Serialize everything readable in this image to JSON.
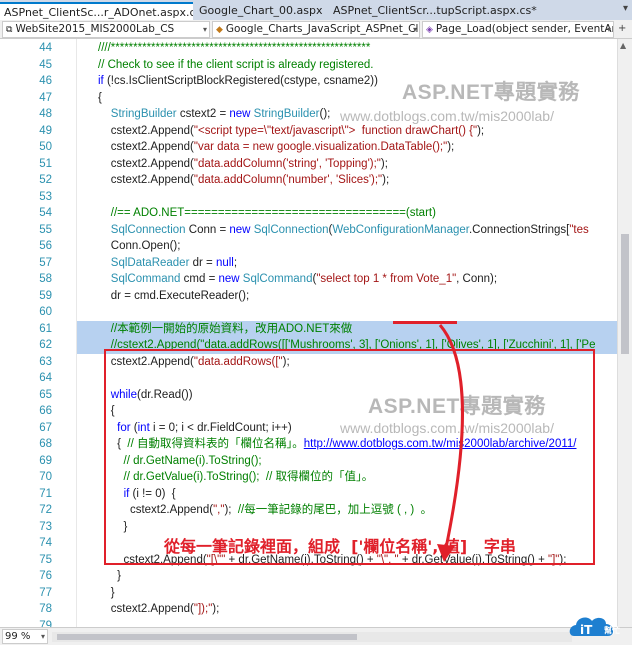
{
  "tabs": [
    {
      "label": "ASPnet_ClientSc...r_ADOnet.aspx.cs",
      "active": true
    },
    {
      "label": "Google_Chart_00.aspx",
      "active": false
    },
    {
      "label": "ASPnet_ClientScr...tupScript.aspx.cs*",
      "active": false
    }
  ],
  "nav": {
    "project": "WebSite2015_MIS2000Lab_CS",
    "class": "Google_Charts_JavaScript_ASPnet_ClientS",
    "member": "Page_Load(object sender, EventArgs e)"
  },
  "zoom": "99 %",
  "code_lines": [
    {
      "n": "44",
      "tokens": [
        {
          "t": "////**********************************************************",
          "c": "cm"
        }
      ]
    },
    {
      "n": "45",
      "tokens": [
        {
          "t": "// Check to see if the client script is already registered.",
          "c": "cm"
        }
      ]
    },
    {
      "n": "46",
      "tokens": [
        {
          "t": "if",
          "c": "kw"
        },
        {
          "t": " (!cs.IsClientScriptBlockRegistered(cstype, csname2))",
          "c": "pl"
        }
      ]
    },
    {
      "n": "47",
      "tokens": [
        {
          "t": "{",
          "c": "pl"
        }
      ]
    },
    {
      "n": "48",
      "tokens": [
        {
          "t": "    ",
          "c": "pl"
        },
        {
          "t": "StringBuilder",
          "c": "ty"
        },
        {
          "t": " cstext2 = ",
          "c": "pl"
        },
        {
          "t": "new",
          "c": "kw"
        },
        {
          "t": " ",
          "c": "pl"
        },
        {
          "t": "StringBuilder",
          "c": "ty"
        },
        {
          "t": "();",
          "c": "pl"
        }
      ]
    },
    {
      "n": "49",
      "tokens": [
        {
          "t": "    cstext2.Append(",
          "c": "pl"
        },
        {
          "t": "\"<script type=\\\"text/javascript\\\">  function drawChart() {\"",
          "c": "str"
        },
        {
          "t": ");",
          "c": "pl"
        }
      ]
    },
    {
      "n": "50",
      "tokens": [
        {
          "t": "    cstext2.Append(",
          "c": "pl"
        },
        {
          "t": "\"var data = new google.visualization.DataTable();\"",
          "c": "str"
        },
        {
          "t": ");",
          "c": "pl"
        }
      ]
    },
    {
      "n": "51",
      "tokens": [
        {
          "t": "    cstext2.Append(",
          "c": "pl"
        },
        {
          "t": "\"data.addColumn('string', 'Topping');\"",
          "c": "str"
        },
        {
          "t": ");",
          "c": "pl"
        }
      ]
    },
    {
      "n": "52",
      "tokens": [
        {
          "t": "    cstext2.Append(",
          "c": "pl"
        },
        {
          "t": "\"data.addColumn('number', 'Slices');\"",
          "c": "str"
        },
        {
          "t": ");",
          "c": "pl"
        }
      ]
    },
    {
      "n": "53",
      "tokens": []
    },
    {
      "n": "54",
      "tokens": [
        {
          "t": "    //== ADO.NET=================================(start)",
          "c": "cm"
        }
      ]
    },
    {
      "n": "55",
      "tokens": [
        {
          "t": "    ",
          "c": "pl"
        },
        {
          "t": "SqlConnection",
          "c": "ty"
        },
        {
          "t": " Conn = ",
          "c": "pl"
        },
        {
          "t": "new",
          "c": "kw"
        },
        {
          "t": " ",
          "c": "pl"
        },
        {
          "t": "SqlConnection",
          "c": "ty"
        },
        {
          "t": "(",
          "c": "pl"
        },
        {
          "t": "WebConfigurationManager",
          "c": "ty"
        },
        {
          "t": ".ConnectionStrings[",
          "c": "pl"
        },
        {
          "t": "\"tes",
          "c": "str"
        }
      ]
    },
    {
      "n": "56",
      "tokens": [
        {
          "t": "    Conn.Open();",
          "c": "pl"
        }
      ]
    },
    {
      "n": "57",
      "tokens": [
        {
          "t": "    ",
          "c": "pl"
        },
        {
          "t": "SqlDataReader",
          "c": "ty"
        },
        {
          "t": " dr = ",
          "c": "pl"
        },
        {
          "t": "null",
          "c": "kw"
        },
        {
          "t": ";",
          "c": "pl"
        }
      ]
    },
    {
      "n": "58",
      "tokens": [
        {
          "t": "    ",
          "c": "pl"
        },
        {
          "t": "SqlCommand",
          "c": "ty"
        },
        {
          "t": " cmd = ",
          "c": "pl"
        },
        {
          "t": "new",
          "c": "kw"
        },
        {
          "t": " ",
          "c": "pl"
        },
        {
          "t": "SqlCommand",
          "c": "ty"
        },
        {
          "t": "(",
          "c": "pl"
        },
        {
          "t": "\"select top 1 * from Vote_1\"",
          "c": "str"
        },
        {
          "t": ", Conn);",
          "c": "pl"
        }
      ]
    },
    {
      "n": "59",
      "tokens": [
        {
          "t": "    dr = cmd.ExecuteReader();",
          "c": "pl"
        }
      ]
    },
    {
      "n": "60",
      "tokens": []
    },
    {
      "n": "61",
      "tokens": [
        {
          "t": "    //本範例一開始的原始資料，改用ADO.NET來做",
          "c": "cm"
        }
      ],
      "selected": true
    },
    {
      "n": "62",
      "tokens": [
        {
          "t": "    //cstext2.Append(\"data.addRows([['Mushrooms', 3], ['Onions', 1], ['Olives', 1], ['Zucchini', 1], ['Pe",
          "c": "cm"
        }
      ],
      "selected": true
    },
    {
      "n": "63",
      "tokens": [
        {
          "t": "    cstext2.Append(",
          "c": "pl"
        },
        {
          "t": "\"data.addRows([\"",
          "c": "str"
        },
        {
          "t": ");",
          "c": "pl"
        }
      ]
    },
    {
      "n": "64",
      "tokens": []
    },
    {
      "n": "65",
      "tokens": [
        {
          "t": "    ",
          "c": "pl"
        },
        {
          "t": "while",
          "c": "kw"
        },
        {
          "t": "(dr.Read())",
          "c": "pl"
        }
      ]
    },
    {
      "n": "66",
      "tokens": [
        {
          "t": "    {",
          "c": "pl"
        }
      ]
    },
    {
      "n": "67",
      "tokens": [
        {
          "t": "      ",
          "c": "pl"
        },
        {
          "t": "for",
          "c": "kw"
        },
        {
          "t": " (",
          "c": "pl"
        },
        {
          "t": "int",
          "c": "kw"
        },
        {
          "t": " i = 0; i < dr.FieldCount; i++)",
          "c": "pl"
        }
      ]
    },
    {
      "n": "68",
      "tokens": [
        {
          "t": "      {  ",
          "c": "pl"
        },
        {
          "t": "// 自動取得資料表的「欄位名稱」。",
          "c": "cm"
        },
        {
          "t": "http://www.dotblogs.com.tw/mis2000lab/archive/2011/",
          "c": "url"
        }
      ]
    },
    {
      "n": "69",
      "tokens": [
        {
          "t": "        // dr.GetName(i).ToString();",
          "c": "cm"
        }
      ]
    },
    {
      "n": "70",
      "tokens": [
        {
          "t": "        // dr.GetValue(i).ToString();  // 取得欄位的「值」。",
          "c": "cm"
        }
      ]
    },
    {
      "n": "71",
      "tokens": [
        {
          "t": "        ",
          "c": "pl"
        },
        {
          "t": "if",
          "c": "kw"
        },
        {
          "t": " (i != 0)  {",
          "c": "pl"
        }
      ]
    },
    {
      "n": "72",
      "tokens": [
        {
          "t": "          cstext2.Append(",
          "c": "pl"
        },
        {
          "t": "\",\"",
          "c": "str"
        },
        {
          "t": ");  ",
          "c": "pl"
        },
        {
          "t": "//每一筆記錄的尾巴，加上逗號 ( , )  。",
          "c": "cm"
        }
      ]
    },
    {
      "n": "73",
      "tokens": [
        {
          "t": "        }",
          "c": "pl"
        }
      ]
    },
    {
      "n": "74",
      "tokens": []
    },
    {
      "n": "75",
      "tokens": [
        {
          "t": "        cstext2.Append(",
          "c": "pl"
        },
        {
          "t": "\"[\\\"\"",
          "c": "str"
        },
        {
          "t": " + dr.GetName(i).ToString() + ",
          "c": "pl"
        },
        {
          "t": "\"\\\", \"",
          "c": "str"
        },
        {
          "t": " + dr.GetValue(i).ToString() + ",
          "c": "pl"
        },
        {
          "t": "\"]\"",
          "c": "str"
        },
        {
          "t": ");",
          "c": "pl"
        }
      ]
    },
    {
      "n": "76",
      "tokens": [
        {
          "t": "      }",
          "c": "pl"
        }
      ]
    },
    {
      "n": "77",
      "tokens": [
        {
          "t": "    }",
          "c": "pl"
        }
      ]
    },
    {
      "n": "78",
      "tokens": [
        {
          "t": "    cstext2.Append(",
          "c": "pl"
        },
        {
          "t": "\"]);\"",
          "c": "str"
        },
        {
          "t": ");",
          "c": "pl"
        }
      ]
    },
    {
      "n": "79",
      "tokens": []
    }
  ],
  "watermark_top": {
    "title": "ASP.NET專題實務",
    "url": "www.dotblogs.com.tw/mis2000lab/"
  },
  "watermark_mid": {
    "title": "ASP.NET專題實務",
    "url": "www.dotblogs.com.tw/mis2000lab/"
  },
  "annotation": {
    "caption": "從每一筆記錄裡面，組成  ['欄位名稱', 值]   字串",
    "color": "#e0202a"
  },
  "logo": {
    "text": "iT",
    "sub": "幫忙",
    "color": "#1e7fd0"
  },
  "colors": {
    "keyword": "#0000ff",
    "type": "#2b91af",
    "string": "#a31515",
    "comment": "#008000",
    "selection": "#b7d1f0",
    "tab_accent": "#007acc"
  }
}
